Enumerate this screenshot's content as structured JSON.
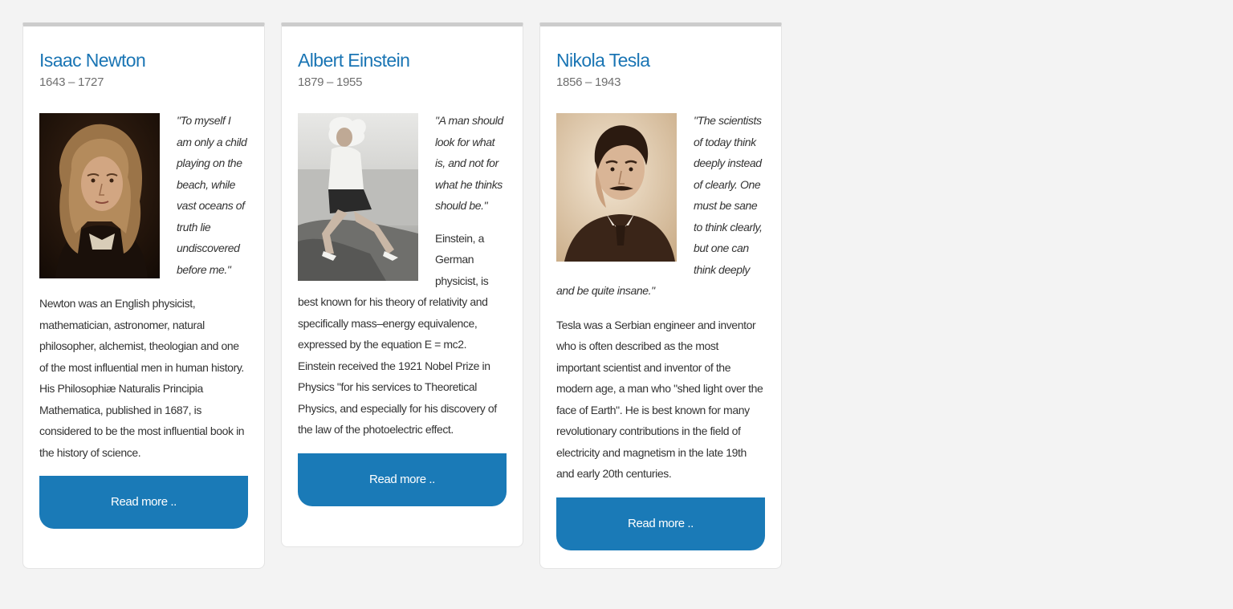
{
  "cards": [
    {
      "name": "Isaac Newton",
      "years": "1643 – 1727",
      "quote": "\"To myself I am only a child playing on the beach, while vast oceans of truth lie undiscovered before me.\"",
      "bio": "Newton was an English physicist, mathematician, astronomer, natural philosopher, alchemist, theologian and one of the most influential men in human history. His Philosophiæ Naturalis Principia Mathematica, published in 1687, is considered to be the most influential book in the history of science.",
      "button": "Read more .."
    },
    {
      "name": "Albert Einstein",
      "years": "1879 – 1955",
      "quote": "\"A man should look for what is, and not for what he thinks should be.\"",
      "bio": "Einstein, a German physicist, is best known for his theory of relativity and specifically mass–energy equivalence, expressed by the equation E = mc2. Einstein received the 1921 Nobel Prize in Physics \"for his services to Theoretical Physics, and especially for his discovery of the law of the photoelectric effect.",
      "button": "Read more .."
    },
    {
      "name": "Nikola Tesla",
      "years": "1856 – 1943",
      "quote": "\"The scientists of today think deeply instead of clearly. One must be sane to think clearly, but one can think deeply and be quite insane.\"",
      "bio": "Tesla was a Serbian engineer and inventor who is often described as the most important scientist and inventor of the modern age, a man who \"shed light over the face of Earth\". He is best known for many revolutionary contributions in the field of electricity and magnetism in the late 19th and early 20th centuries.",
      "button": "Read more .."
    }
  ],
  "colors": {
    "accent": "#1a75b4",
    "button": "#1a7ab7",
    "card_top_border": "#cccccc",
    "background": "#f3f3f3"
  }
}
